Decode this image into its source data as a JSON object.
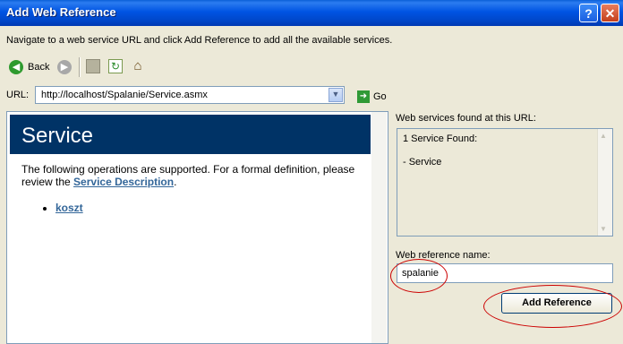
{
  "window": {
    "title": "Add Web Reference",
    "help_label": "?",
    "close_label": "✕"
  },
  "instruction": "Navigate to a web service URL and click Add Reference to add all the available services.",
  "toolbar": {
    "back_label": "Back",
    "back_icon": "back-arrow-icon",
    "forward_icon": "forward-arrow-icon",
    "stop_icon": "stop-icon",
    "refresh_icon": "refresh-icon",
    "home_icon": "home-icon"
  },
  "url_bar": {
    "label": "URL:",
    "value": "http://localhost/Spalanie/Service.asmx",
    "go_label": "Go"
  },
  "browser": {
    "service_title": "Service",
    "intro_text": "The following operations are supported. For a formal definition, please review the",
    "description_link": "Service Description",
    "period": ".",
    "operations": [
      "koszt"
    ]
  },
  "results": {
    "label": "Web services found at this URL:",
    "count_text": "1 Service Found:",
    "items": [
      "- Service"
    ]
  },
  "reference": {
    "label": "Web reference name:",
    "value": "spalanie",
    "add_button": "Add Reference"
  },
  "colors": {
    "titlebar": "#0054e3",
    "banner": "#003366",
    "link": "#336699",
    "annotation": "#cc0000"
  }
}
